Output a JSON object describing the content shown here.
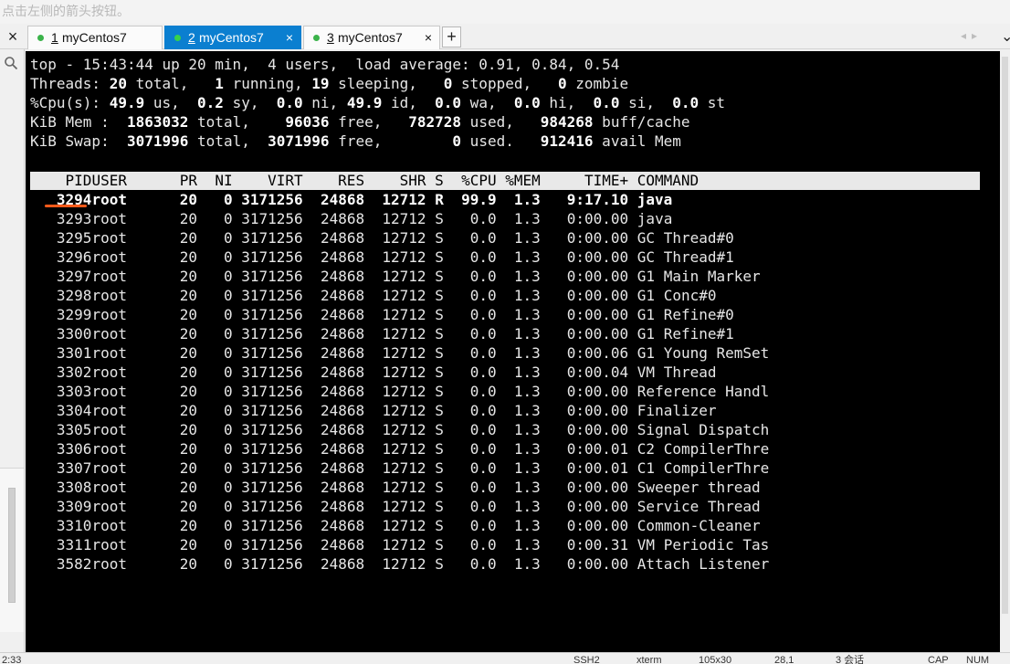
{
  "hint": "点击左侧的箭头按钮。",
  "tabs": [
    {
      "num": "1",
      "label": "myCentos7",
      "close": "×"
    },
    {
      "num": "2",
      "label": "myCentos7",
      "close": "×"
    },
    {
      "num": "3",
      "label": "myCentos7",
      "close": "×"
    }
  ],
  "tabbar": {
    "add": "+",
    "close": "×",
    "prev": "◂",
    "next": "▸",
    "collapse": "⌄"
  },
  "icons": {
    "search": "search-icon"
  },
  "top": {
    "summary": "top - 15:43:44 up 20 min,  4 users,  load average: 0.91, 0.84, 0.54",
    "tasks": {
      "label": "Threads:",
      "total": "20",
      "running": "1",
      "sleeping": "19",
      "stopped": "0",
      "zombie": "0"
    },
    "cpu": {
      "label": "%Cpu(s):",
      "us": "49.9",
      "sy": "0.2",
      "ni": "0.0",
      "id": "49.9",
      "wa": "0.0",
      "hi": "0.0",
      "si": "0.0",
      "st": "0.0"
    },
    "mem": {
      "label": "KiB Mem :",
      "total": "1863032",
      "free": "96036",
      "used": "782728",
      "cache": "984268"
    },
    "swap": {
      "label": "KiB Swap:",
      "total": "3071996",
      "free": "3071996",
      "used": "0",
      "avail": "912416"
    }
  },
  "table": {
    "columns": [
      "PID",
      "USER",
      "PR",
      "NI",
      "VIRT",
      "RES",
      "SHR",
      "S",
      "%CPU",
      "%MEM",
      "TIME+",
      "COMMAND"
    ],
    "rows": [
      [
        "3294",
        "root",
        "20",
        "0",
        "3171256",
        "24868",
        "12712",
        "R",
        "99.9",
        "1.3",
        "9:17.10",
        "java"
      ],
      [
        "3293",
        "root",
        "20",
        "0",
        "3171256",
        "24868",
        "12712",
        "S",
        "0.0",
        "1.3",
        "0:00.00",
        "java"
      ],
      [
        "3295",
        "root",
        "20",
        "0",
        "3171256",
        "24868",
        "12712",
        "S",
        "0.0",
        "1.3",
        "0:00.00",
        "GC Thread#0"
      ],
      [
        "3296",
        "root",
        "20",
        "0",
        "3171256",
        "24868",
        "12712",
        "S",
        "0.0",
        "1.3",
        "0:00.00",
        "GC Thread#1"
      ],
      [
        "3297",
        "root",
        "20",
        "0",
        "3171256",
        "24868",
        "12712",
        "S",
        "0.0",
        "1.3",
        "0:00.00",
        "G1 Main Marker"
      ],
      [
        "3298",
        "root",
        "20",
        "0",
        "3171256",
        "24868",
        "12712",
        "S",
        "0.0",
        "1.3",
        "0:00.00",
        "G1 Conc#0"
      ],
      [
        "3299",
        "root",
        "20",
        "0",
        "3171256",
        "24868",
        "12712",
        "S",
        "0.0",
        "1.3",
        "0:00.00",
        "G1 Refine#0"
      ],
      [
        "3300",
        "root",
        "20",
        "0",
        "3171256",
        "24868",
        "12712",
        "S",
        "0.0",
        "1.3",
        "0:00.00",
        "G1 Refine#1"
      ],
      [
        "3301",
        "root",
        "20",
        "0",
        "3171256",
        "24868",
        "12712",
        "S",
        "0.0",
        "1.3",
        "0:00.06",
        "G1 Young RemSet"
      ],
      [
        "3302",
        "root",
        "20",
        "0",
        "3171256",
        "24868",
        "12712",
        "S",
        "0.0",
        "1.3",
        "0:00.04",
        "VM Thread"
      ],
      [
        "3303",
        "root",
        "20",
        "0",
        "3171256",
        "24868",
        "12712",
        "S",
        "0.0",
        "1.3",
        "0:00.00",
        "Reference Handl"
      ],
      [
        "3304",
        "root",
        "20",
        "0",
        "3171256",
        "24868",
        "12712",
        "S",
        "0.0",
        "1.3",
        "0:00.00",
        "Finalizer"
      ],
      [
        "3305",
        "root",
        "20",
        "0",
        "3171256",
        "24868",
        "12712",
        "S",
        "0.0",
        "1.3",
        "0:00.00",
        "Signal Dispatch"
      ],
      [
        "3306",
        "root",
        "20",
        "0",
        "3171256",
        "24868",
        "12712",
        "S",
        "0.0",
        "1.3",
        "0:00.01",
        "C2 CompilerThre"
      ],
      [
        "3307",
        "root",
        "20",
        "0",
        "3171256",
        "24868",
        "12712",
        "S",
        "0.0",
        "1.3",
        "0:00.01",
        "C1 CompilerThre"
      ],
      [
        "3308",
        "root",
        "20",
        "0",
        "3171256",
        "24868",
        "12712",
        "S",
        "0.0",
        "1.3",
        "0:00.00",
        "Sweeper thread"
      ],
      [
        "3309",
        "root",
        "20",
        "0",
        "3171256",
        "24868",
        "12712",
        "S",
        "0.0",
        "1.3",
        "0:00.00",
        "Service Thread"
      ],
      [
        "3310",
        "root",
        "20",
        "0",
        "3171256",
        "24868",
        "12712",
        "S",
        "0.0",
        "1.3",
        "0:00.00",
        "Common-Cleaner"
      ],
      [
        "3311",
        "root",
        "20",
        "0",
        "3171256",
        "24868",
        "12712",
        "S",
        "0.0",
        "1.3",
        "0:00.31",
        "VM Periodic Tas"
      ],
      [
        "3582",
        "root",
        "20",
        "0",
        "3171256",
        "24868",
        "12712",
        "S",
        "0.0",
        "1.3",
        "0:00.00",
        "Attach Listener"
      ]
    ]
  },
  "statusbar": {
    "left": "2:33",
    "items": [
      "SSH2",
      "xterm",
      "105x30",
      "28,1",
      "3 会话",
      "CAP",
      "NUM"
    ]
  },
  "colors": {
    "accent": "#0b7fd0",
    "terminal_bg": "#000000",
    "header_bg": "#e9e9e9",
    "marker": "#ff5a1a",
    "status_dot": "#3bb34a"
  }
}
